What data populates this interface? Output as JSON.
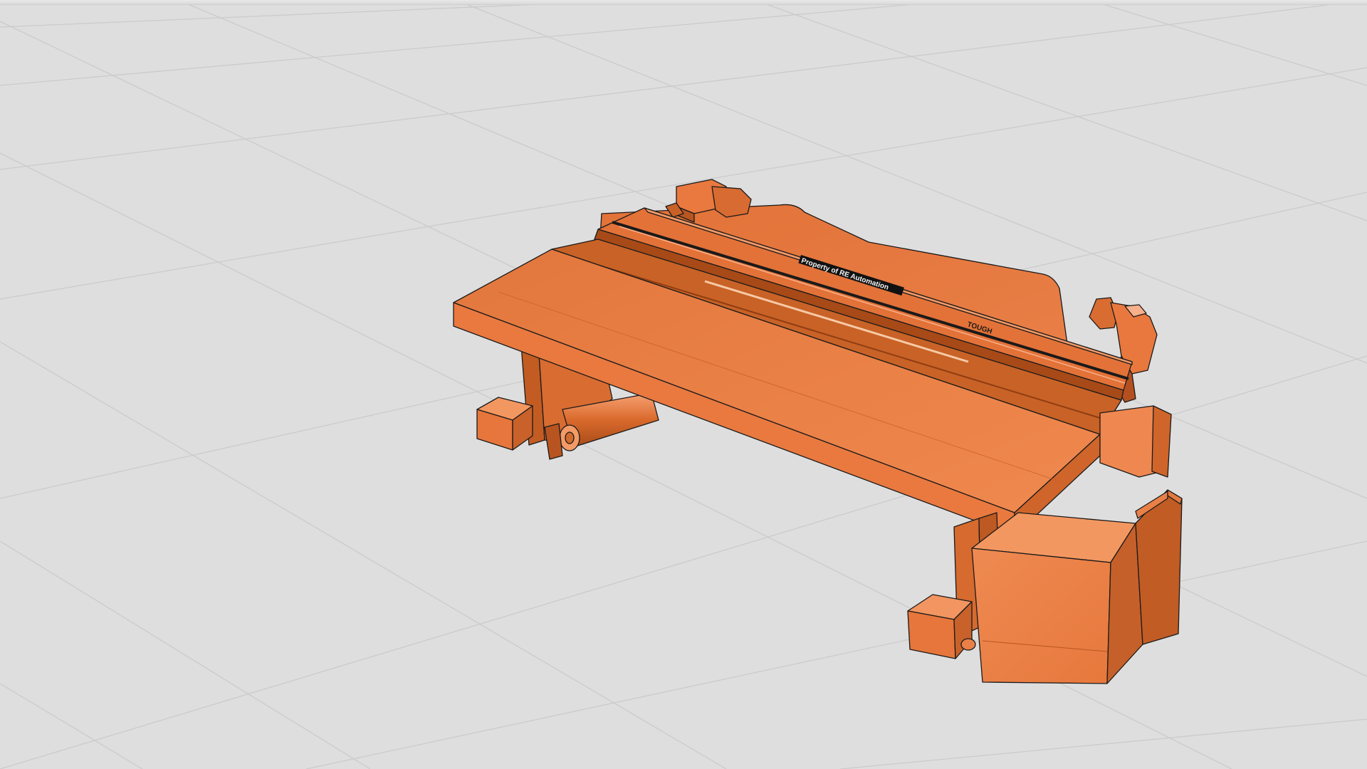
{
  "viewer": {
    "model_label": "Property of RE Automation",
    "model_label_secondary": "TOUGH",
    "colors": {
      "background": "#dedede",
      "grid_line": "#c9c9c9",
      "model_light": "#f0884f",
      "model_mid": "#e2763c",
      "model_dark": "#b9561f",
      "model_darker": "#8f3c12",
      "edge": "#1a1a1a"
    }
  }
}
